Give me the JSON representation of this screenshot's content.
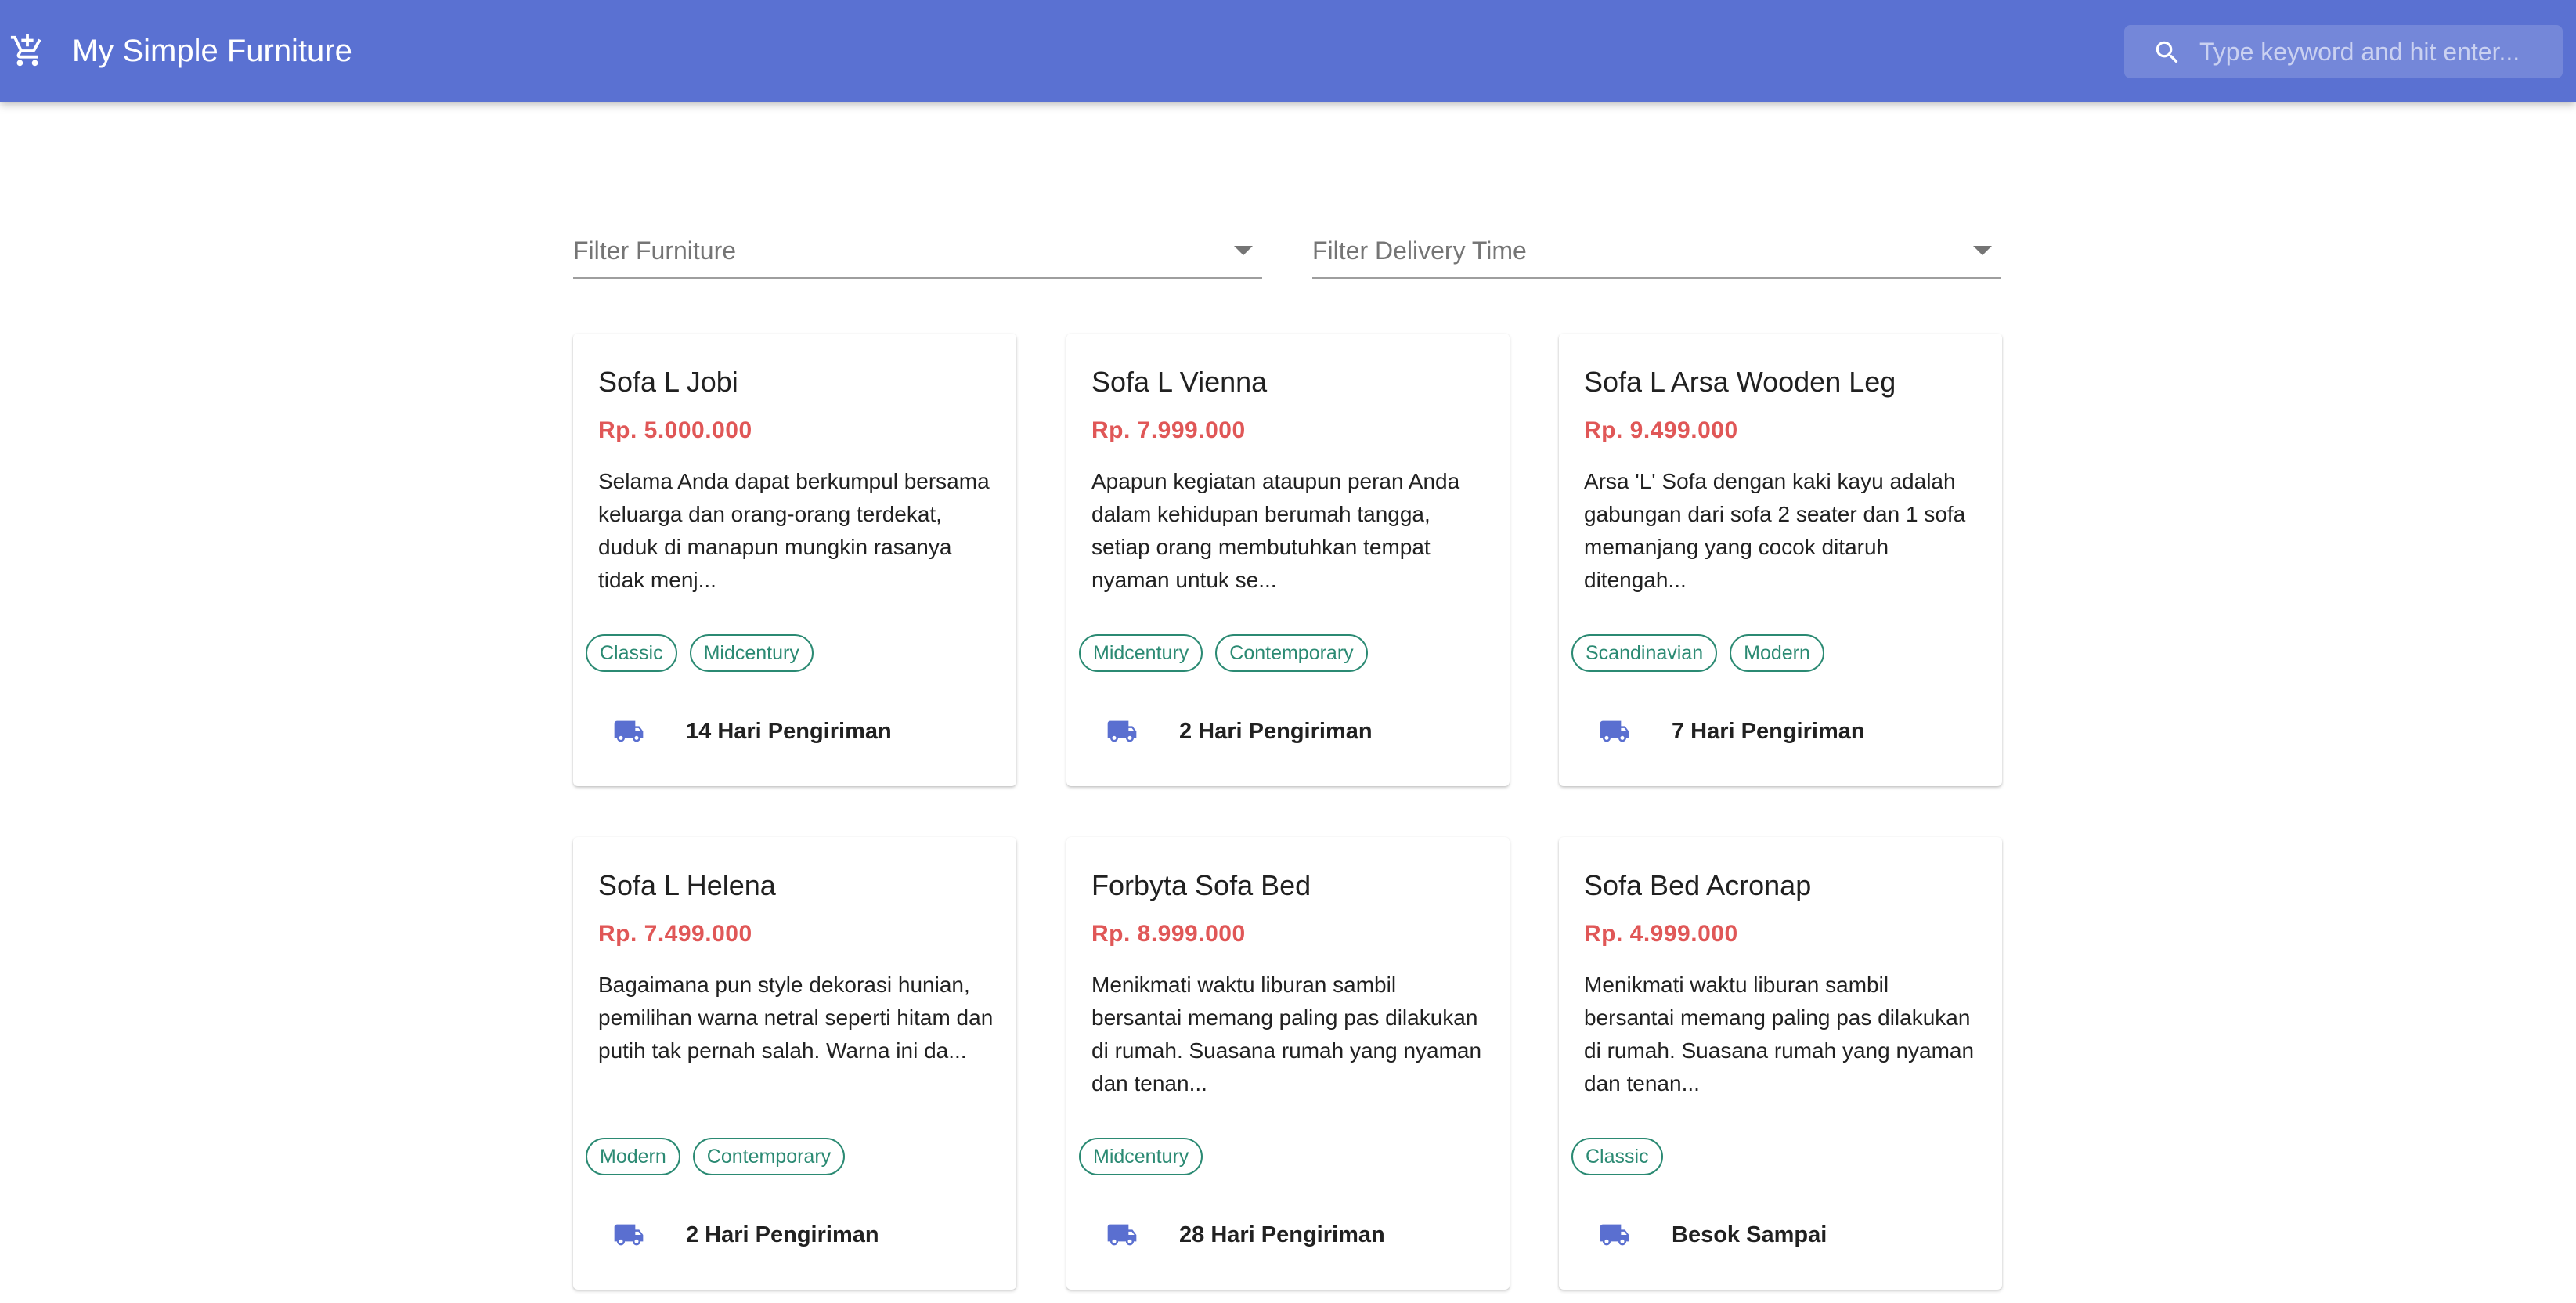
{
  "appbar": {
    "title": "My Simple Furniture",
    "icon": "cart-icon",
    "search": {
      "placeholder": "Type keyword and hit enter...",
      "value": ""
    }
  },
  "filters": {
    "furniture": {
      "label": "Filter Furniture"
    },
    "delivery_time": {
      "label": "Filter Delivery Time"
    }
  },
  "colors": {
    "appbar": "#5a71d2",
    "price": "#e05757",
    "chip": "#2b8a73",
    "truck": "#5a6fd0"
  },
  "products": [
    {
      "name": "Sofa L Jobi",
      "price": "Rp. 5.000.000",
      "description": "Selama Anda dapat berkumpul bersama keluarga dan orang-orang terdekat, duduk di manapun mungkin rasanya tidak menj...",
      "styles": [
        "Classic",
        "Midcentury"
      ],
      "delivery": "14 Hari Pengiriman"
    },
    {
      "name": "Sofa L Vienna",
      "price": "Rp. 7.999.000",
      "description": "Apapun kegiatan ataupun peran Anda dalam kehidupan berumah tangga, setiap orang membutuhkan tempat nyaman untuk se...",
      "styles": [
        "Midcentury",
        "Contemporary"
      ],
      "delivery": "2 Hari Pengiriman"
    },
    {
      "name": "Sofa L Arsa Wooden Leg",
      "price": "Rp. 9.499.000",
      "description": "Arsa 'L' Sofa dengan kaki kayu adalah gabungan dari sofa 2 seater dan 1 sofa memanjang yang cocok ditaruh ditengah...",
      "styles": [
        "Scandinavian",
        "Modern"
      ],
      "delivery": "7 Hari Pengiriman"
    },
    {
      "name": "Sofa L Helena",
      "price": "Rp. 7.499.000",
      "description": "Bagaimana pun style dekorasi hunian, pemilihan warna netral seperti hitam dan putih tak pernah salah. Warna ini da...",
      "styles": [
        "Modern",
        "Contemporary"
      ],
      "delivery": "2 Hari Pengiriman"
    },
    {
      "name": "Forbyta Sofa Bed",
      "price": "Rp. 8.999.000",
      "description": "Menikmati waktu liburan sambil bersantai memang paling pas dilakukan di rumah. Suasana rumah yang nyaman dan tenan...",
      "styles": [
        "Midcentury"
      ],
      "delivery": "28 Hari Pengiriman"
    },
    {
      "name": "Sofa Bed Acronap",
      "price": "Rp. 4.999.000",
      "description": "Menikmati waktu liburan sambil bersantai memang paling pas dilakukan di rumah. Suasana rumah yang nyaman dan tenan...",
      "styles": [
        "Classic"
      ],
      "delivery": "Besok Sampai"
    }
  ]
}
